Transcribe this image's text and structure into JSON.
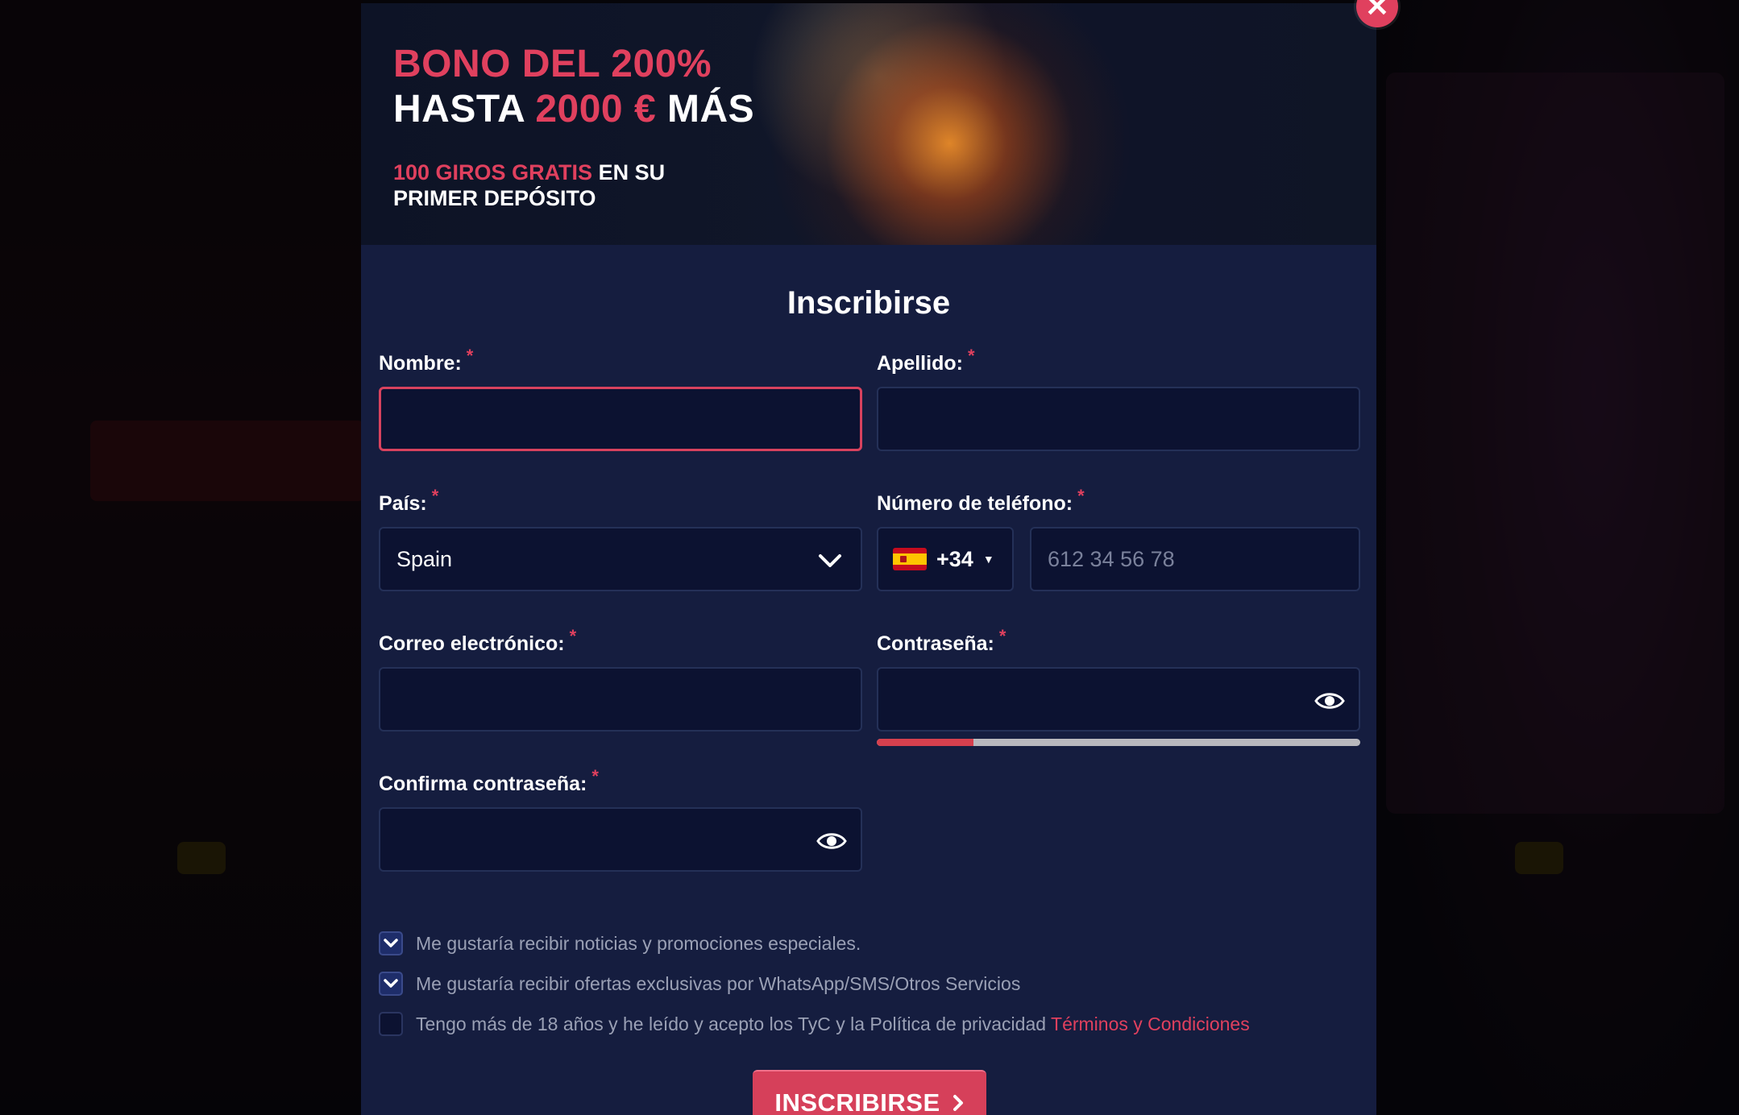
{
  "banner": {
    "line1": "BONO DEL 200%",
    "line2_a": "HASTA ",
    "line2_b": "2000 €",
    "line2_c": " MÁS",
    "sub_a": "100 GIROS GRATIS",
    "sub_b": " EN SU",
    "sub_c": "PRIMER DEPÓSITO"
  },
  "close_icon": "close-icon",
  "form": {
    "title": "Inscribirse",
    "required_mark": "*",
    "first_name": {
      "label": "Nombre:",
      "value": ""
    },
    "last_name": {
      "label": "Apellido:",
      "value": ""
    },
    "country": {
      "label": "País:",
      "value": "Spain"
    },
    "phone": {
      "label": "Número de teléfono:",
      "prefix": "+34",
      "placeholder": "612 34 56 78"
    },
    "email": {
      "label": "Correo electrónico:",
      "value": ""
    },
    "password": {
      "label": "Contraseña:",
      "value": "",
      "strength": 0.2
    },
    "confirm_password": {
      "label": "Confirma contraseña:",
      "value": ""
    },
    "checkboxes": [
      {
        "label": "Me gustaría recibir noticias y promociones especiales.",
        "checked": true
      },
      {
        "label": "Me gustaría recibir ofertas exclusivas por WhatsApp/SMS/Otros Servicios",
        "checked": true
      },
      {
        "label": "Tengo más de 18 años y he leído y acepto los TyC y la Política de privacidad ",
        "link": "Términos y Condiciones",
        "checked": false
      }
    ],
    "submit_label": "INSCRIBIRSE"
  },
  "colors": {
    "accent": "#e0405e",
    "modal_bg": "#151d3f",
    "input_bg": "#0c1231"
  }
}
